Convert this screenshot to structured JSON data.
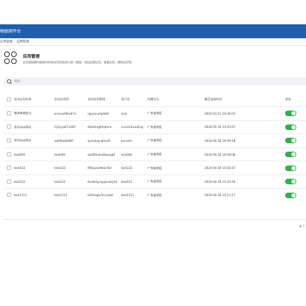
{
  "header": {
    "title": "物联网平台"
  },
  "breadcrumb": [
    "应用管理",
    "应用管理"
  ],
  "section": {
    "title": "应用管理",
    "description": "应用管理模块能够对所有应用系统进行统一管理，包括创建应用，查看应用，删除应用等。"
  },
  "search": {
    "placeholder": "搜索"
  },
  "table": {
    "columns": [
      "北向应用名称",
      "北向应用ID",
      "北向应用密钥",
      "用户名",
      "所属节点",
      "最后连接时间",
      "状态"
    ],
    "rows": [
      {
        "name": "物流车辆定位",
        "app_id": "znsxxsfd6e67e",
        "secret": "rgsjxsuzrqhbfe",
        "user": "root",
        "node": "广东省地区",
        "time": "2024-03-21 10:40:03",
        "status": "on"
      },
      {
        "name": "北向app测试",
        "app_id": "i1j2yya67a187",
        "secret": "6tpktrxgt4rqhna",
        "user": "currentLoading",
        "node": "广东省地区",
        "time": "2024-05-10 14:43:57",
        "status": "on"
      },
      {
        "name": "北向app测试",
        "app_id": "aafd6ab8d87",
        "secret": "spxiukayiqhvxfi",
        "user": "bxceshi",
        "node": "广东省地区",
        "time": "2024-04-30 16:09:18",
        "status": "on"
      },
      {
        "name": "test000",
        "app_id": "test000",
        "secret": "dad65rwxdtwaxgtf",
        "user": "test000",
        "node": "广东省地区",
        "time": "2024-04-30 16:08:08",
        "status": "on"
      },
      {
        "name": "test333",
        "app_id": "test333",
        "secret": "f06ywxs9ldcd4d",
        "user": "test333",
        "node": "广东省地区",
        "time": "2024-04-30 15:54:47",
        "status": "on"
      },
      {
        "name": "test222",
        "app_id": "test222",
        "secret": "6xdw5ysxpjisxdxj34",
        "user": "test222",
        "node": "广东省地区",
        "time": "2024-04-30 15:43:10",
        "status": "on"
      },
      {
        "name": "test1111",
        "app_id": "test1111",
        "secret": "k2tlxsgtx5ccyxe6",
        "user": "test1111",
        "node": "广东省地区",
        "time": "2024-04-30 15:13:17",
        "status": "on"
      }
    ]
  },
  "footer": {
    "text": "共 7"
  },
  "colors": {
    "header_bg": "#1f5fae",
    "toggle_on": "#2eb04d"
  }
}
